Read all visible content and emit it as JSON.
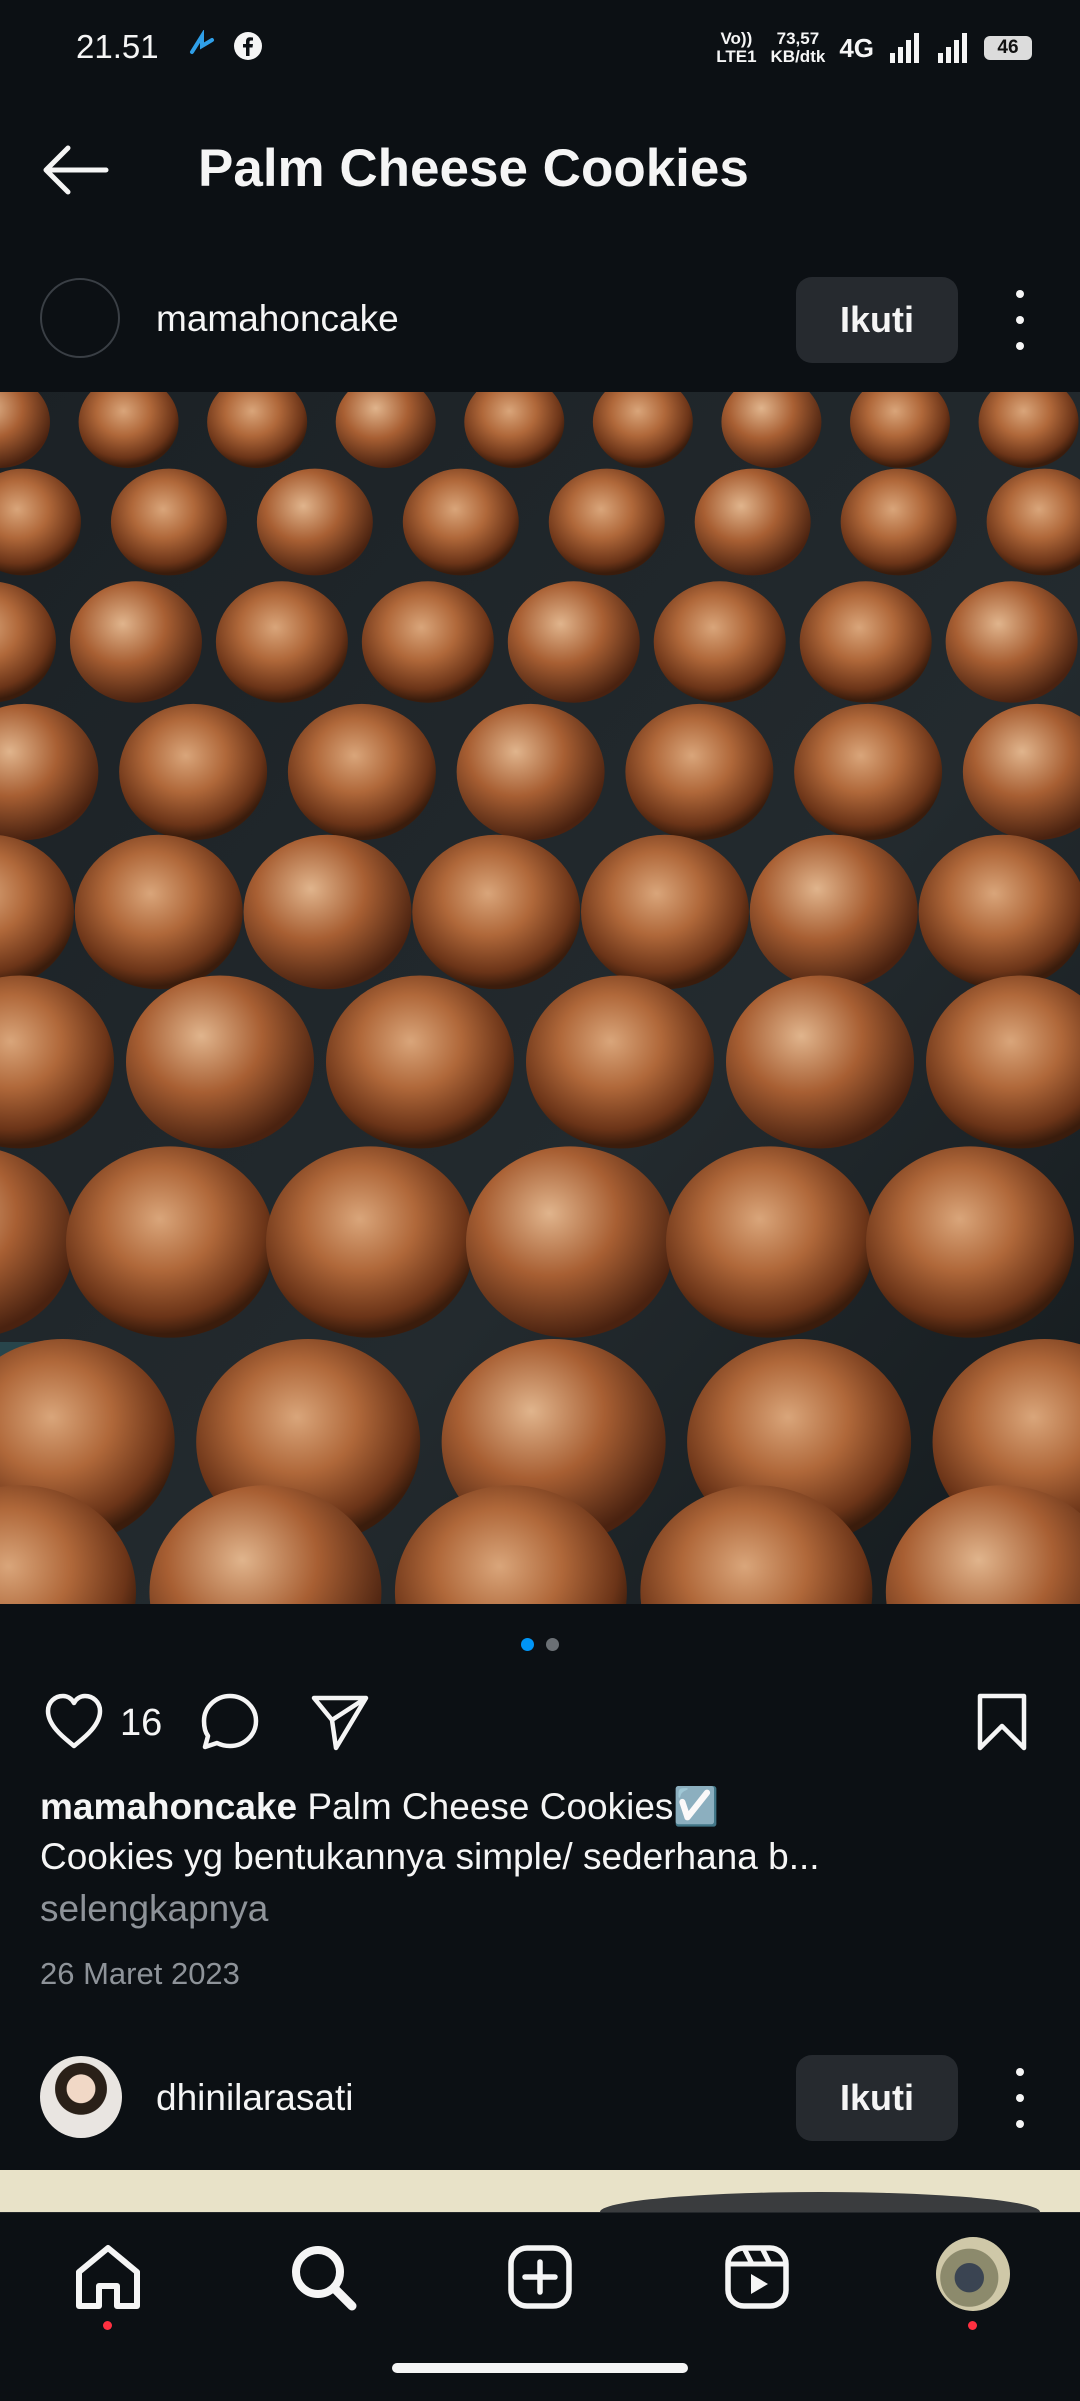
{
  "status_bar": {
    "time": "21.51",
    "volte_label_top": "Vo))",
    "volte_label_bottom": "LTE1",
    "speed_top": "73,57",
    "speed_bottom": "KB/dtk",
    "network": "4G",
    "battery": "46"
  },
  "header": {
    "title": "Palm Cheese Cookies"
  },
  "post": {
    "username": "mamahoncake",
    "follow_label": "Ikuti",
    "carousel_pages": 2,
    "carousel_active": 1,
    "like_count": "16",
    "caption_username": "mamahoncake",
    "caption_title": "Palm Cheese Cookies☑️",
    "caption_line2": "Cookies yg bentukannya simple/ sederhana b...",
    "more_link": "selengkapnya",
    "date": "26 Maret 2023"
  },
  "next_post": {
    "username": "dhinilarasati",
    "follow_label": "Ikuti"
  },
  "bottom_nav": {
    "items": [
      "home-icon",
      "search-icon",
      "add-post-icon",
      "reels-icon",
      "profile-avatar"
    ]
  },
  "colors": {
    "background": "#0c1014",
    "accent_blue": "#0095f6",
    "button_bg": "#262a2f",
    "notification_red": "#ff3040"
  }
}
